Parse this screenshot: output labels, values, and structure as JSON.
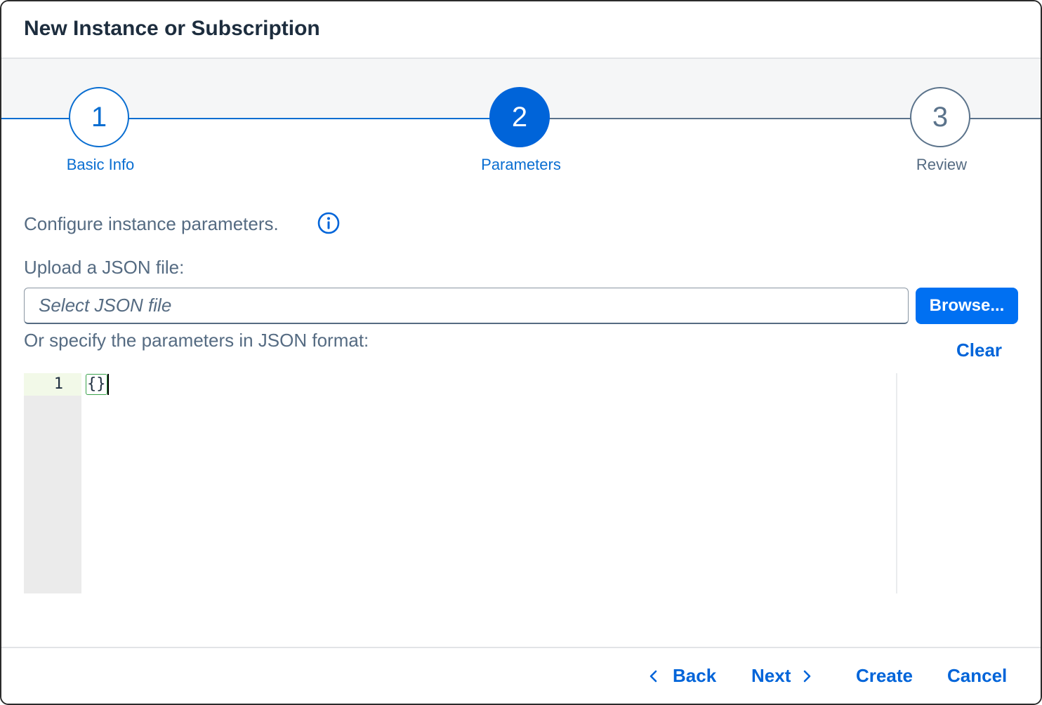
{
  "dialog": {
    "title": "New Instance or Subscription"
  },
  "wizard": {
    "steps": [
      {
        "number": "1",
        "label": "Basic Info",
        "state": "completed"
      },
      {
        "number": "2",
        "label": "Parameters",
        "state": "active"
      },
      {
        "number": "3",
        "label": "Review",
        "state": "upcoming"
      }
    ]
  },
  "content": {
    "intro": "Configure instance parameters.",
    "info_icon": "info-icon",
    "upload_label": "Upload a JSON file:",
    "file_placeholder": "Select JSON file",
    "browse_label": "Browse...",
    "json_label": "Or specify the parameters in JSON format:",
    "clear_label": "Clear",
    "editor": {
      "line_number": "1",
      "code": "{}"
    }
  },
  "footer": {
    "back_label": "Back",
    "next_label": "Next",
    "create_label": "Create",
    "cancel_label": "Cancel"
  },
  "colors": {
    "accent": "#0064d9",
    "button_primary": "#0070f2",
    "text_secondary": "#556b82"
  }
}
